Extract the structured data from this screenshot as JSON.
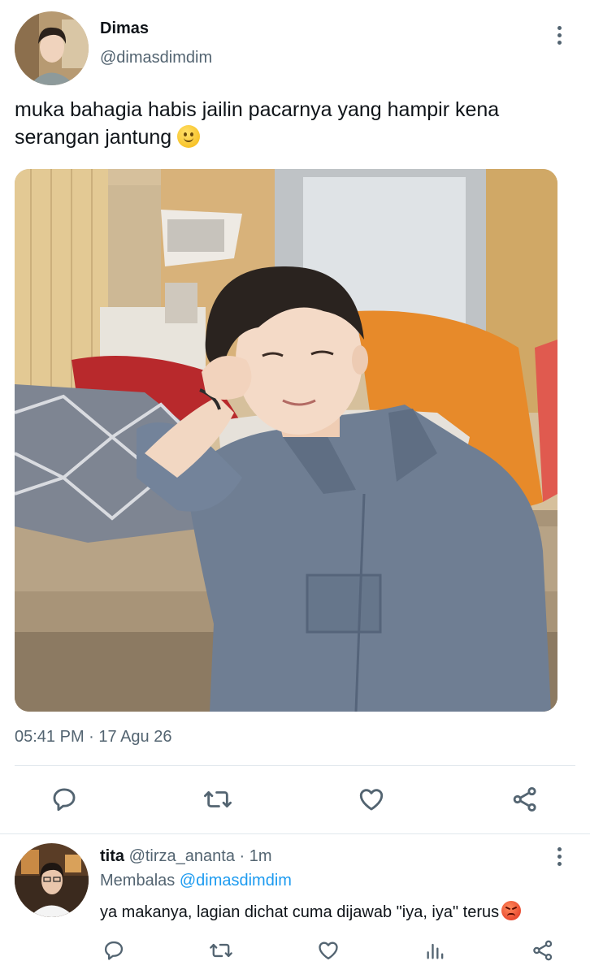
{
  "tweet": {
    "author_name": "Dimas",
    "author_handle": "@dimasdimdim",
    "text": "muka bahagia habis jailin pacarnya yang hampir kena serangan jantung",
    "text_emoji": "slightly-smiling-face",
    "photo_description_icon": "photo",
    "timestamp": "05:41 PM · 17 Agu 26",
    "actions": [
      "reply-icon",
      "retweet-icon",
      "like-icon",
      "share-icon"
    ]
  },
  "reply": {
    "author_name": "tita",
    "author_handle": "@tirza_ananta",
    "time_ago": "· 1m",
    "replying_prefix": "Membalas",
    "replying_to": "@dimasdimdim",
    "text": "ya makanya, lagian dichat cuma dijawab \"iya, iya\" terus",
    "text_emoji": "angry-face",
    "actions": [
      "reply-icon",
      "retweet-icon",
      "like-icon",
      "analytics-icon",
      "share-icon"
    ]
  },
  "colors": {
    "text": "#0f1419",
    "secondary": "#536471",
    "link": "#1d9bf0",
    "divider": "#e1e8ed"
  }
}
